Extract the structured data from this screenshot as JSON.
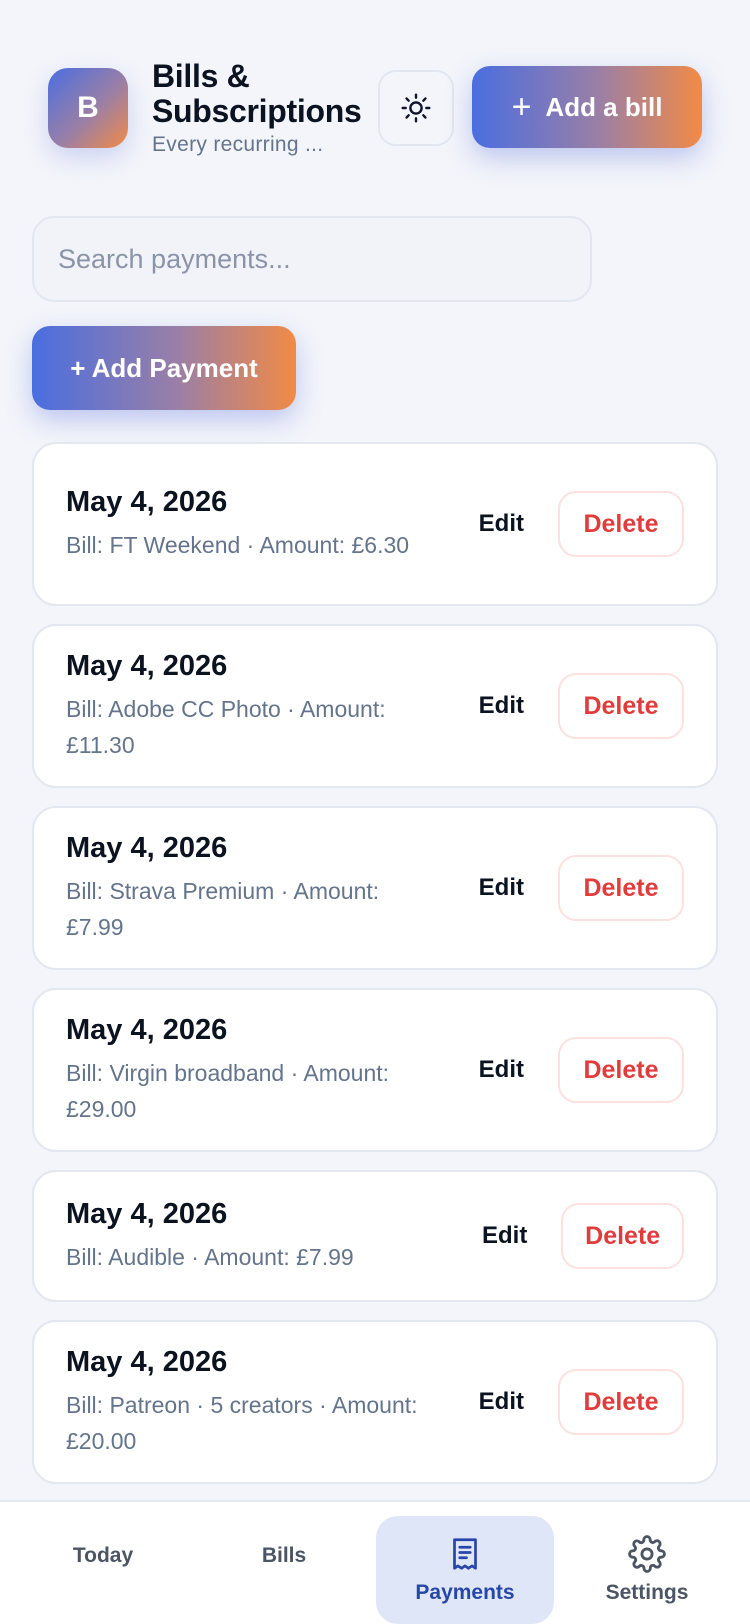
{
  "header": {
    "logo_letter": "B",
    "title": "Bills & Subscriptions",
    "subtitle": "Every recurring ...",
    "theme_icon": "sun-icon",
    "add_bill_label": "Add a bill"
  },
  "search": {
    "placeholder": "Search payments..."
  },
  "add_payment_label": "+ Add Payment",
  "payments": [
    {
      "date": "May 4, 2026",
      "description": "Bill: FT Weekend · Amount: £6.30",
      "edit": "Edit",
      "delete": "Delete"
    },
    {
      "date": "May 4, 2026",
      "description": "Bill: Adobe CC Photo · Amount: £11.30",
      "edit": "Edit",
      "delete": "Delete"
    },
    {
      "date": "May 4, 2026",
      "description": "Bill: Strava Premium · Amount: £7.99",
      "edit": "Edit",
      "delete": "Delete"
    },
    {
      "date": "May 4, 2026",
      "description": "Bill: Virgin broadband · Amount: £29.00",
      "edit": "Edit",
      "delete": "Delete"
    },
    {
      "date": "May 4, 2026",
      "description": "Bill: Audible · Amount: £7.99",
      "edit": "Edit",
      "delete": "Delete"
    },
    {
      "date": "May 4, 2026",
      "description": "Bill: Patreon · 5 creators · Amount: £20.00",
      "edit": "Edit",
      "delete": "Delete"
    }
  ],
  "nav": {
    "today": "Today",
    "bills": "Bills",
    "payments": "Payments",
    "settings": "Settings",
    "active": "payments"
  },
  "colors": {
    "accent_start": "#4a6ee0",
    "accent_end": "#f28a45",
    "delete": "#e23b3b",
    "active_nav_bg": "#dfe6f8",
    "active_nav_text": "#2747a8"
  }
}
